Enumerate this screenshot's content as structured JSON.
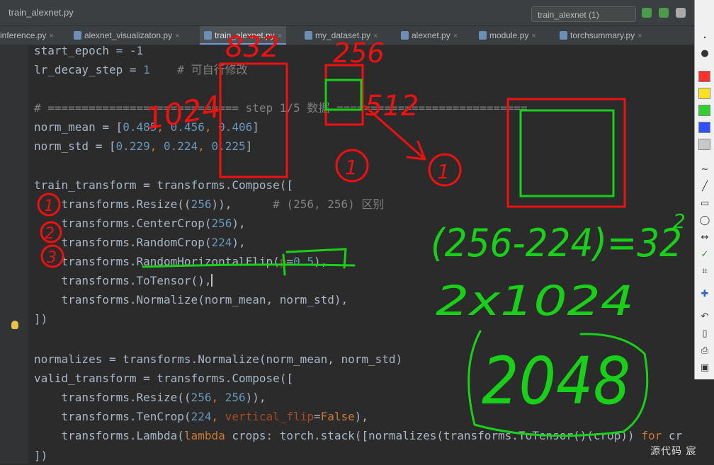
{
  "window": {
    "title": "train_alexnet.py",
    "run_config": "train_alexnet (1)"
  },
  "tabs": [
    {
      "label": "inference.py",
      "active": false
    },
    {
      "label": "alexnet_visualizaton.py",
      "active": false
    },
    {
      "label": "train_alexnet.py",
      "active": true
    },
    {
      "label": "my_dataset.py",
      "active": false
    },
    {
      "label": "alexnet.py",
      "active": false
    },
    {
      "label": "module.py",
      "active": false
    },
    {
      "label": "torchsummary.py",
      "active": false
    }
  ],
  "tab_close": "×",
  "code": {
    "l1": "start_epoch = -1",
    "l2a": "lr_decay_step = ",
    "l2b": "1",
    "l2c": "    # 可自行修改",
    "l3": "# ============================ step 1/5 数据 ============================",
    "l4a": "norm_mean = [",
    "l4b": "0.485",
    "l4c": ", ",
    "l4d": "0.456",
    "l4e": ", ",
    "l4f": "0.406",
    "l4g": "]",
    "l5a": "norm_std = [",
    "l5b": "0.229",
    "l5c": ", ",
    "l5d": "0.224",
    "l5e": ", ",
    "l5f": "0.225",
    "l5g": "]",
    "l6": "train_transform = transforms.Compose([",
    "l7a": "    transforms.Resize((",
    "l7b": "256",
    "l7c": ")),      ",
    "l7d": "# (256, 256) 区别",
    "l8a": "    transforms.CenterCrop(",
    "l8b": "256",
    "l8c": "),",
    "l9a": "    transforms.RandomCrop(",
    "l9b": "224",
    "l9c": "),",
    "l10a": "    transforms.RandomHorizontalFlip(",
    "l10b": "p",
    "l10c": "=",
    "l10d": "0.5",
    "l10e": "),",
    "l11": "    transforms.ToTensor(),",
    "l12": "    transforms.Normalize(norm_mean, norm_std),",
    "l13": "])",
    "l14": "normalizes = transforms.Normalize(norm_mean, norm_std)",
    "l15": "valid_transform = transforms.Compose([",
    "l16a": "    transforms.Resize((",
    "l16b": "256",
    "l16c": ", ",
    "l16d": "256",
    "l16e": ")),",
    "l17a": "    transforms.TenCrop(",
    "l17b": "224",
    "l17c": ", ",
    "l17d": "vertical_flip",
    "l17e": "=",
    "l17f": "False",
    "l17g": "),",
    "l18a": "    transforms.Lambda(",
    "l18b": "lambda",
    "l18c": " crops: torch.stack([normalizes(transforms.ToTensor()(crop)) ",
    "l18d": "for",
    "l18e": " cr",
    "l19": "])"
  },
  "annotations": {
    "red": [
      "832",
      "256",
      "1024",
      "512",
      "1",
      "1",
      "1",
      "2",
      "3"
    ],
    "green": [
      "(256-224)=32",
      "2",
      "2x1024",
      "2048"
    ]
  },
  "watermark": "源代码  宸",
  "colors": {
    "red_ink": "#f01010",
    "green_ink": "#18d018",
    "keyword": "#cc7832",
    "number": "#6897bb"
  },
  "toolbar_icons": [
    "pen-icon",
    "line-icon",
    "rectangle-icon",
    "ellipse-icon",
    "arrow-icon",
    "check-icon",
    "crop-icon",
    "plus-icon",
    "undo-icon",
    "page-icon",
    "print-icon",
    "screen-icon"
  ]
}
